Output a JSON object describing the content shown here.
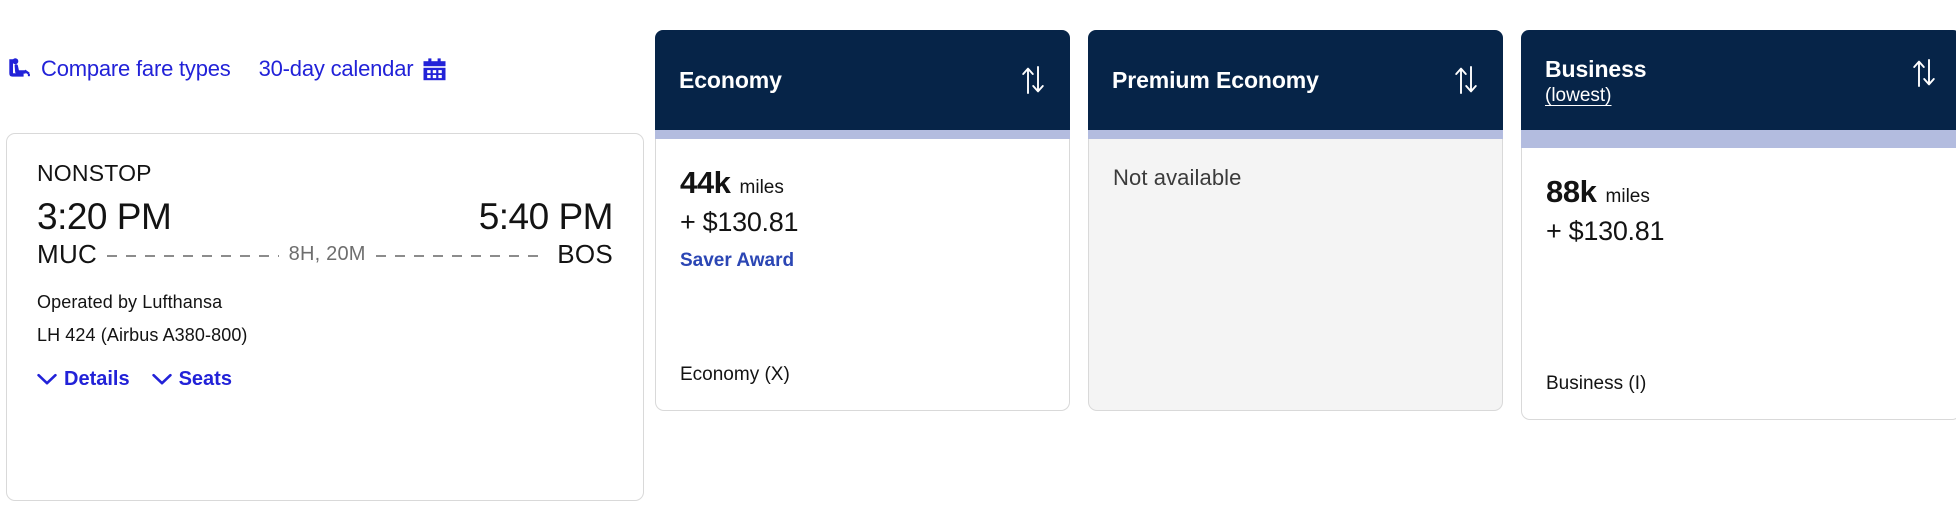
{
  "toolbar": {
    "compare_label": "Compare fare types",
    "calendar_label": "30-day calendar",
    "seat_icon": "seat-icon",
    "calendar_icon": "calendar-icon",
    "link_color": "#2222D8"
  },
  "flight": {
    "stops": "NONSTOP",
    "depart_time": "3:20 PM",
    "arrive_time": "5:40 PM",
    "origin": "MUC",
    "destination": "BOS",
    "duration": "8H, 20M",
    "operated_by": "Operated by Lufthansa",
    "flight_number": "LH 424 (Airbus A380-800)",
    "details_label": "Details",
    "seats_label": "Seats"
  },
  "fares": [
    {
      "name": "Economy",
      "subtitle": "",
      "available": true,
      "miles": "44k",
      "miles_unit": "miles",
      "cash": "+ $130.81",
      "award_type": "Saver Award",
      "class_code": "Economy (X)",
      "unavailable_text": "",
      "sort_icon": "sort-arrows-icon"
    },
    {
      "name": "Premium Economy",
      "subtitle": "",
      "available": false,
      "miles": "",
      "miles_unit": "",
      "cash": "",
      "award_type": "",
      "class_code": "",
      "unavailable_text": "Not available",
      "sort_icon": "sort-arrows-icon"
    },
    {
      "name": "Business",
      "subtitle": "(lowest)",
      "available": true,
      "miles": "88k",
      "miles_unit": "miles",
      "cash": "+ $130.81",
      "award_type": "",
      "class_code": "Business (I)",
      "unavailable_text": "",
      "sort_icon": "sort-arrows-icon"
    }
  ],
  "colors": {
    "header_navy": "#062448",
    "accent_lavender": "#B3BCDF",
    "link_blue": "#2222D8",
    "award_blue": "#2B46B4",
    "unavailable_bg": "#F4F4F4"
  }
}
